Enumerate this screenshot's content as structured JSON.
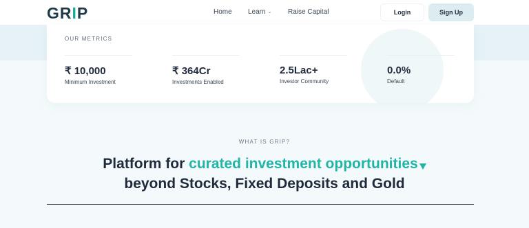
{
  "header": {
    "logo": {
      "part1": "GR",
      "part2": "I",
      "part3": "P"
    },
    "nav": {
      "home": "Home",
      "learn": "Learn",
      "raise_capital": "Raise Capital"
    },
    "login_label": "Login",
    "signup_label": "Sign Up"
  },
  "metrics": {
    "title": "OUR METRICS",
    "items": [
      {
        "value": "₹ 10,000",
        "label": "Minimum Investment"
      },
      {
        "value": "₹ 364Cr",
        "label": "Investments Enabled"
      },
      {
        "value": "2.5Lac+",
        "label": "Investor Community"
      },
      {
        "value": "0.0%",
        "label": "Default"
      }
    ]
  },
  "about": {
    "eyebrow": "WHAT IS GRIP?",
    "headline_lead": "Platform for ",
    "headline_highlight": "curated investment opportunities",
    "headline_line2": "beyond Stocks, Fixed Deposits and Gold"
  },
  "colors": {
    "accent": "#22b5a6",
    "text_dark": "#1f2a3c",
    "signup_bg": "#dcecf1"
  },
  "icons": {
    "learn_dropdown": "chevron-down-icon",
    "headline_marker": "triangle-down-icon"
  }
}
